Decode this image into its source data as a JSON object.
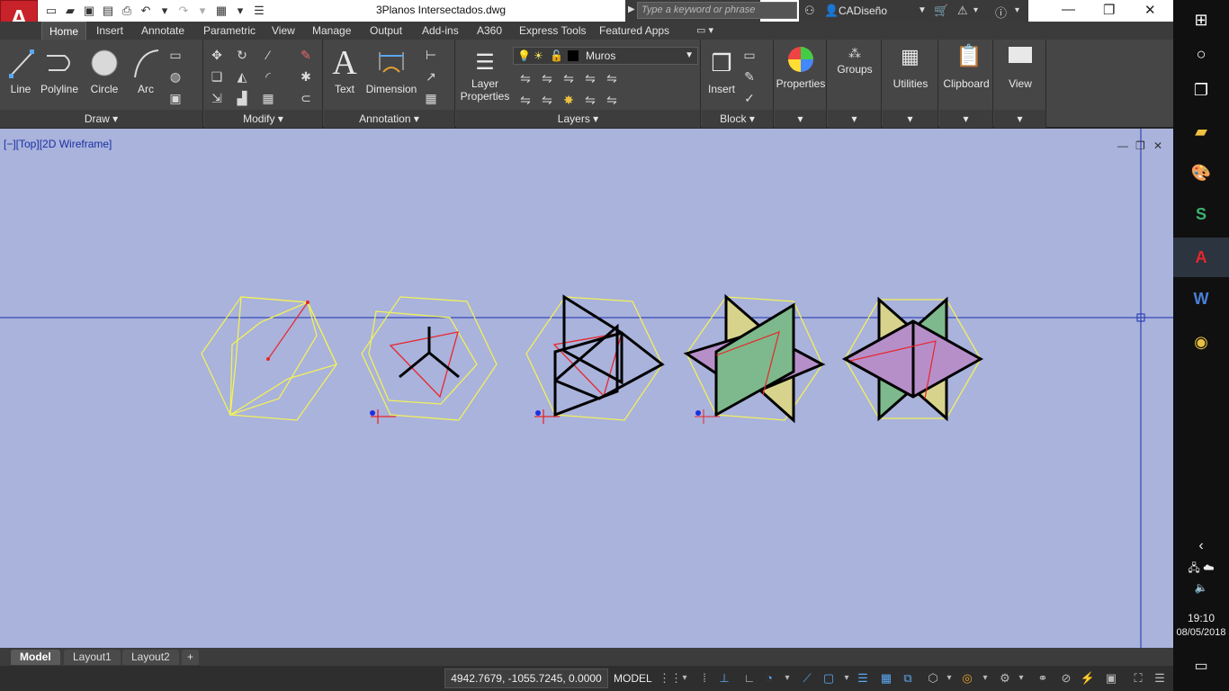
{
  "title": {
    "document": "3Planos Intersectados.dwg",
    "search_placeholder": "Type a keyword or phrase",
    "user": "CADiseño",
    "app_letter": "A"
  },
  "tabs": [
    {
      "label": "Home",
      "active": true
    },
    {
      "label": "Insert"
    },
    {
      "label": "Annotate"
    },
    {
      "label": "Parametric"
    },
    {
      "label": "View"
    },
    {
      "label": "Manage"
    },
    {
      "label": "Output"
    },
    {
      "label": "Add-ins"
    },
    {
      "label": "A360"
    },
    {
      "label": "Express Tools"
    },
    {
      "label": "Featured Apps"
    }
  ],
  "panels": {
    "draw": {
      "title": "Draw",
      "line": "Line",
      "polyline": "Polyline",
      "circle": "Circle",
      "arc": "Arc"
    },
    "modify": {
      "title": "Modify"
    },
    "annotation": {
      "title": "Annotation",
      "text": "Text",
      "dimension": "Dimension"
    },
    "layers": {
      "title": "Layers",
      "layer_props_1": "Layer",
      "layer_props_2": "Properties",
      "current_layer": "Muros"
    },
    "block": {
      "title": "Block",
      "insert": "Insert"
    },
    "properties": {
      "label": "Properties"
    },
    "groups": {
      "label": "Groups"
    },
    "utilities": {
      "label": "Utilities"
    },
    "clipboard": {
      "label": "Clipboard"
    },
    "view": {
      "label": "View"
    }
  },
  "viewport": {
    "label": "[−][Top][2D Wireframe]"
  },
  "layout_tabs": [
    {
      "label": "Model",
      "active": true
    },
    {
      "label": "Layout1"
    },
    {
      "label": "Layout2"
    }
  ],
  "status": {
    "coordinates": "4942.7679, -1055.7245, 0.0000",
    "mode": "MODEL"
  },
  "taskbar": {
    "time": "19:10",
    "date": "08/05/2018"
  },
  "colors": {
    "viewport_bg": "#a9b3dc",
    "hex_line": "#f3f05a",
    "red_line": "#e8262b",
    "plane_green": "#7db98c",
    "plane_yellow": "#d8d38c",
    "plane_purple": "#b68fc9"
  }
}
